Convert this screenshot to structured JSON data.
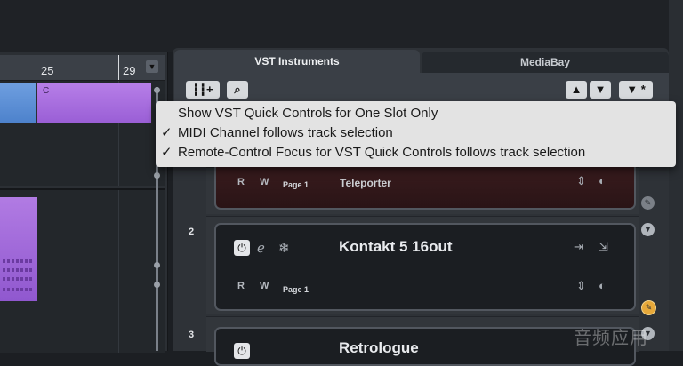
{
  "ruler": {
    "marks": [
      "25",
      "29"
    ]
  },
  "clips": {
    "letter": "C"
  },
  "tabs": {
    "vst_instruments": "VST Instruments",
    "mediabay": "MediaBay"
  },
  "toolbar_icons": [
    "add-instrument-icon",
    "search-icon",
    "move-up-icon",
    "move-down-icon",
    "options-icon"
  ],
  "menu": {
    "items": [
      {
        "check": "",
        "label": "Show VST Quick Controls for One Slot Only"
      },
      {
        "check": "✓",
        "label": "MIDI Channel follows track selection"
      },
      {
        "check": "✓",
        "label": "Remote-Control Focus for VST Quick Controls follows track selection"
      }
    ]
  },
  "slots": [
    {
      "number": "",
      "name": "",
      "r": "R",
      "w": "W",
      "page": "Page 1",
      "preset": "Teleporter"
    },
    {
      "number": "2",
      "name": "Kontakt 5 16out",
      "r": "R",
      "w": "W",
      "page": "Page 1",
      "preset": ""
    },
    {
      "number": "3",
      "name": "Retrologue"
    }
  ],
  "colors": {
    "accent_orange": "#e7a93a",
    "clip_purple": "#a469dd",
    "clip_blue": "#5f93da"
  },
  "watermark": "音频应用"
}
